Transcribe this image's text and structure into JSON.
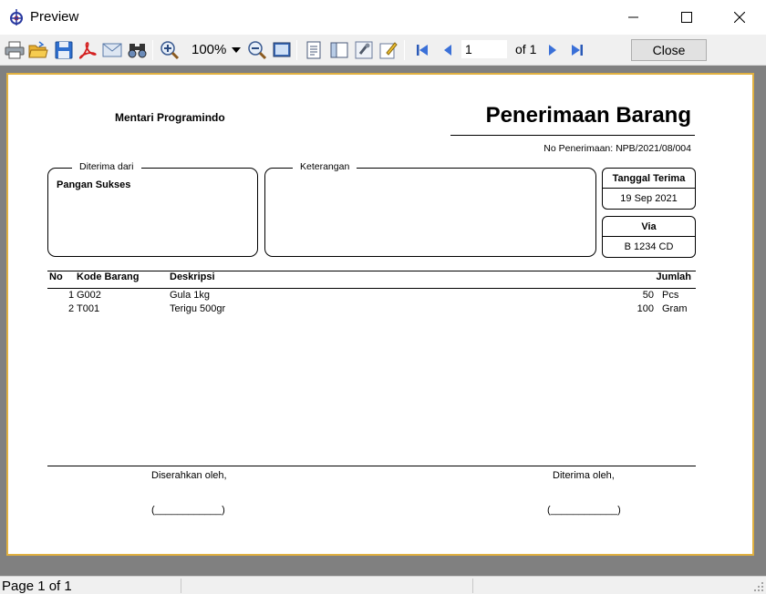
{
  "window": {
    "title": "Preview"
  },
  "toolbar": {
    "zoom_value": "100%",
    "page_input": "1",
    "page_of": "of 1",
    "close_label": "Close"
  },
  "report": {
    "company": "Mentari Programindo",
    "title": "Penerimaan Barang",
    "doc_number": "No Penerimaan: NPB/2021/08/004",
    "received_from_legend": "Diterima dari",
    "received_from_value": "Pangan Sukses",
    "notes_legend": "Keterangan",
    "notes_value": "",
    "date_label": "Tanggal Terima",
    "date_value": "19 Sep 2021",
    "via_label": "Via",
    "via_value": "B 1234 CD",
    "columns": {
      "no": "No",
      "code": "Kode Barang",
      "description": "Deskripsi",
      "qty": "Jumlah"
    },
    "rows": [
      {
        "no": "1",
        "code": "G002",
        "description": "Gula 1kg",
        "qty": "50",
        "unit": "Pcs"
      },
      {
        "no": "2",
        "code": "T001",
        "description": "Terigu 500gr",
        "qty": "100",
        "unit": "Gram"
      }
    ],
    "handed_by_label": "Diserahkan oleh,",
    "received_by_label": "Diterima oleh,",
    "signature_blank": "(____________)"
  },
  "status": {
    "page_text": "Page 1 of 1"
  },
  "colors": {
    "viewer_bg": "#808080",
    "paper_border": "#e0b040",
    "toolbar_bg": "#f0f0f0"
  }
}
